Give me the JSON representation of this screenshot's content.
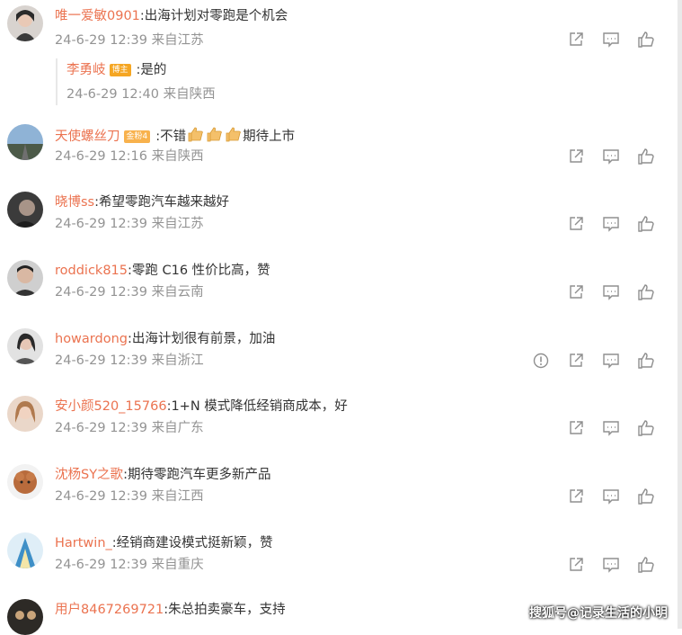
{
  "comments": [
    {
      "user": "唯一爱敏0901",
      "text": ":出海计划对零跑是个机会",
      "time": "24-6-29 12:39",
      "loc": "来自江苏",
      "actions": [
        "share-icon",
        "comment-icon",
        "like-icon"
      ]
    },
    {
      "user": "天使螺丝刀",
      "badge": "金粉4",
      "text_pre": ":不错",
      "text_post": "期待上市",
      "time": "24-6-29 12:16",
      "loc": "来自陕西",
      "actions": [
        "share-icon",
        "comment-icon",
        "like-icon"
      ]
    },
    {
      "user": "晓博ss",
      "text": ":希望零跑汽车越来越好",
      "time": "24-6-29 12:39",
      "loc": "来自江苏",
      "actions": [
        "share-icon",
        "comment-icon",
        "like-icon"
      ]
    },
    {
      "user": "roddick815",
      "text": ":零跑 C16 性价比高，赞",
      "time": "24-6-29 12:39",
      "loc": "来自云南",
      "actions": [
        "share-icon",
        "comment-icon",
        "like-icon"
      ]
    },
    {
      "user": "howardong",
      "text": ":出海计划很有前景，加油",
      "time": "24-6-29 12:39",
      "loc": "来自浙江",
      "actions": [
        "report-icon",
        "share-icon",
        "comment-icon",
        "like-icon"
      ]
    },
    {
      "user": "安小颜520_15766",
      "text": ":1+N 模式降低经销商成本，好",
      "time": "24-6-29 12:39",
      "loc": "来自广东",
      "actions": [
        "share-icon",
        "comment-icon",
        "like-icon"
      ]
    },
    {
      "user": "沈杨SY之歌",
      "text": ":期待零跑汽车更多新产品",
      "time": "24-6-29 12:39",
      "loc": "来自江西",
      "actions": [
        "share-icon",
        "comment-icon",
        "like-icon"
      ]
    },
    {
      "user": "Hartwin_",
      "text": ":经销商建设模式挺新颖，赞",
      "time": "24-6-29 12:39",
      "loc": "来自重庆",
      "actions": [
        "share-icon",
        "comment-icon",
        "like-icon"
      ]
    },
    {
      "user": "用户8467269721",
      "text": ":朱总拍卖豪车，支持",
      "time": "",
      "loc": "",
      "actions": []
    }
  ],
  "reply": {
    "user": "李勇岐",
    "badge": "博主",
    "text": ":是的",
    "time": "24-6-29 12:40",
    "loc": "来自陕西"
  },
  "watermark": "搜狐号@记录生活的小明",
  "colors": {
    "username": "#eb7350",
    "meta": "#939393",
    "icon": "#8f8f8f"
  }
}
